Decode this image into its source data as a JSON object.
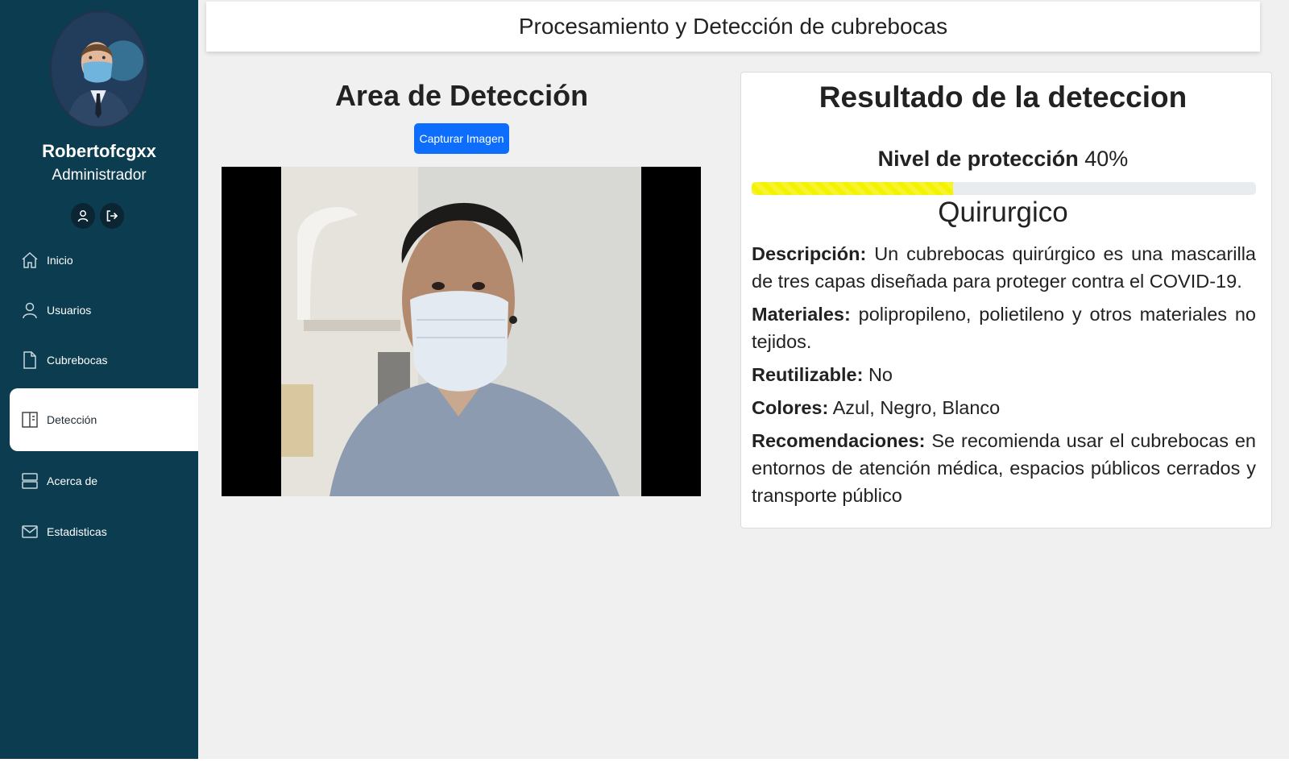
{
  "sidebar": {
    "username": "Robertofcgxx",
    "role": "Administrador",
    "profile_icon": "user-icon",
    "logout_icon": "logout-icon",
    "items": [
      {
        "label": "Inicio",
        "icon": "home-icon",
        "active": false
      },
      {
        "label": "Usuarios",
        "icon": "user-icon",
        "active": false
      },
      {
        "label": "Cubrebocas",
        "icon": "document-icon",
        "active": false
      },
      {
        "label": "Detección",
        "icon": "panel-icon",
        "active": true
      },
      {
        "label": "Acerca de",
        "icon": "server-icon",
        "active": false
      },
      {
        "label": "Estadisticas",
        "icon": "mail-icon",
        "active": false
      }
    ],
    "colors": {
      "background": "#0c3c4f",
      "active_item": "#ffffff"
    }
  },
  "header": {
    "title": "Procesamiento y Detección de cubrebocas"
  },
  "detection": {
    "title": "Area de Detección",
    "capture_button": "Capturar Imagen",
    "button_color": "#0d6efd"
  },
  "result": {
    "title": "Resultado de la deteccion",
    "level_label": "Nivel de protección",
    "level_value": "40%",
    "level_fraction": 0.4,
    "level_color": "#f5f200",
    "mask_type": "Quirurgico",
    "description_label": "Descripción:",
    "description": "Un cubrebocas quirúrgico es una mascarilla de tres capas diseñada para proteger contra el COVID-19.",
    "materials_label": "Materiales:",
    "materials": "polipropileno, polietileno y otros materiales no tejidos.",
    "reusable_label": "Reutilizable:",
    "reusable": "No",
    "colors_label": "Colores:",
    "colors": "Azul, Negro, Blanco",
    "recommendations_label": "Recomendaciones:",
    "recommendations": "Se recomienda usar el cubrebocas en entornos de atención médica, espacios públicos cerrados y transporte público"
  }
}
